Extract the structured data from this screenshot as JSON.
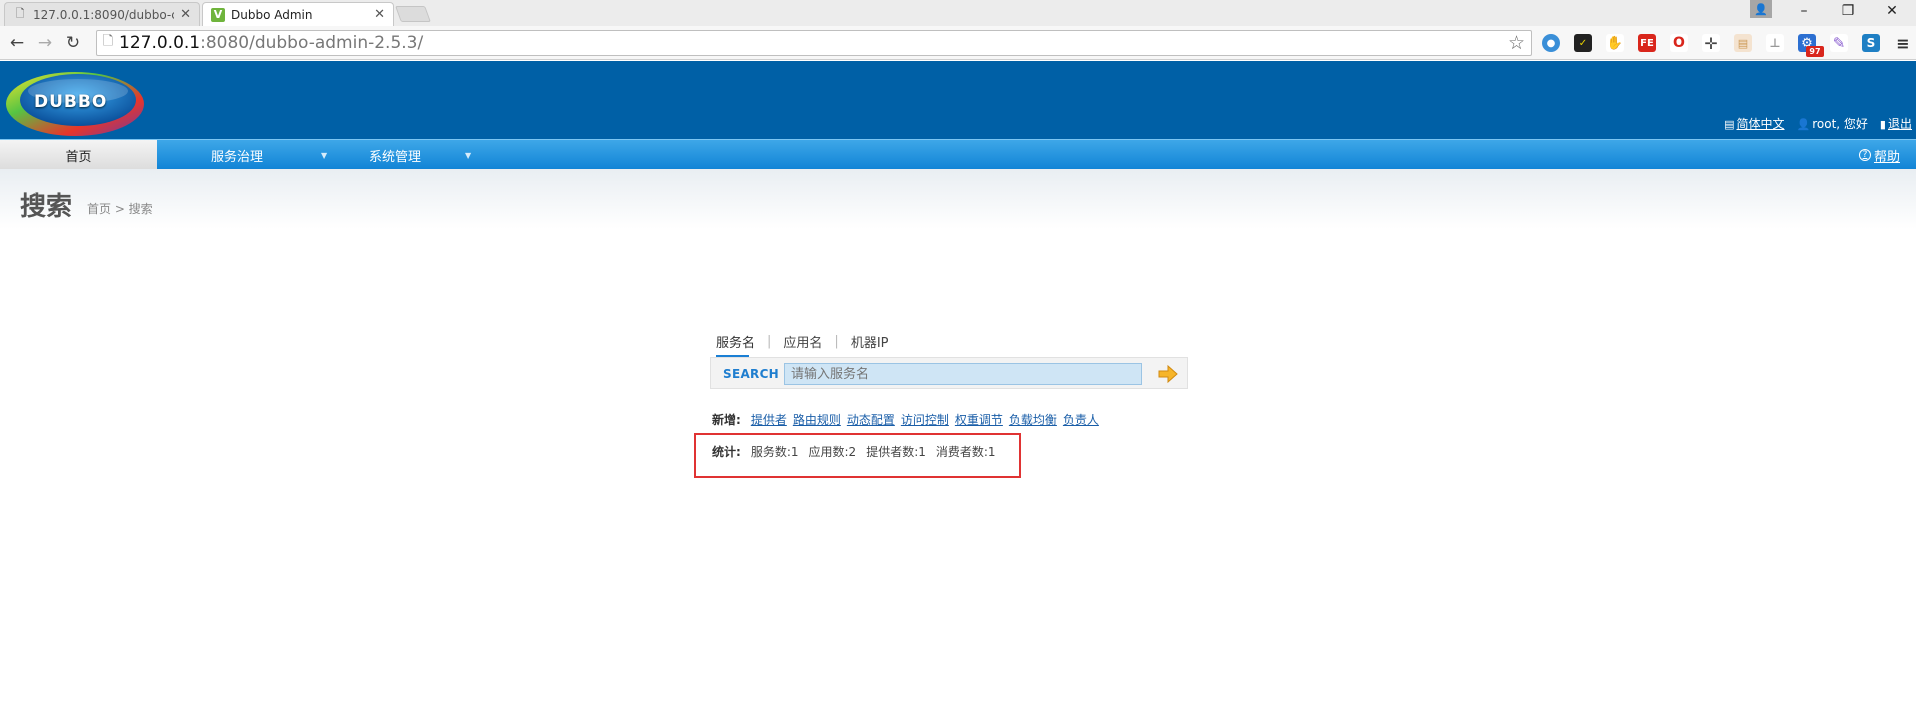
{
  "browser": {
    "tabs": [
      {
        "title": "127.0.0.1:8090/dubbo-c",
        "active": false
      },
      {
        "title": "Dubbo Admin",
        "active": true
      }
    ],
    "url_host": "127.0.0.1",
    "url_path": ":8080/dubbo-admin-2.5.3/",
    "extensions_badge": "97",
    "window_controls": {
      "minimize": "–",
      "restore": "❐",
      "close": "✕"
    }
  },
  "header": {
    "logo_text": "DUBBO",
    "user_links": {
      "language": "简体中文",
      "user": "root, 您好",
      "logout": "退出"
    }
  },
  "menu": {
    "items": [
      "首页",
      "服务治理",
      "系统管理"
    ],
    "help": "帮助"
  },
  "page": {
    "title": "搜索",
    "breadcrumb": "首页 > 搜索"
  },
  "search": {
    "tabs": [
      "服务名",
      "应用名",
      "机器IP"
    ],
    "label": "SEARCH",
    "placeholder": "请输入服务名"
  },
  "add": {
    "label": "新增:",
    "links": [
      "提供者",
      "路由规则",
      "动态配置",
      "访问控制",
      "权重调节",
      "负载均衡",
      "负责人"
    ]
  },
  "stats": {
    "label": "统计:",
    "items": [
      "服务数:1",
      "应用数:2",
      "提供者数:1",
      "消费者数:1"
    ]
  },
  "colors": {
    "header": "#0060a6",
    "menubar": "#1184d6",
    "highlight_box": "#e03333"
  }
}
